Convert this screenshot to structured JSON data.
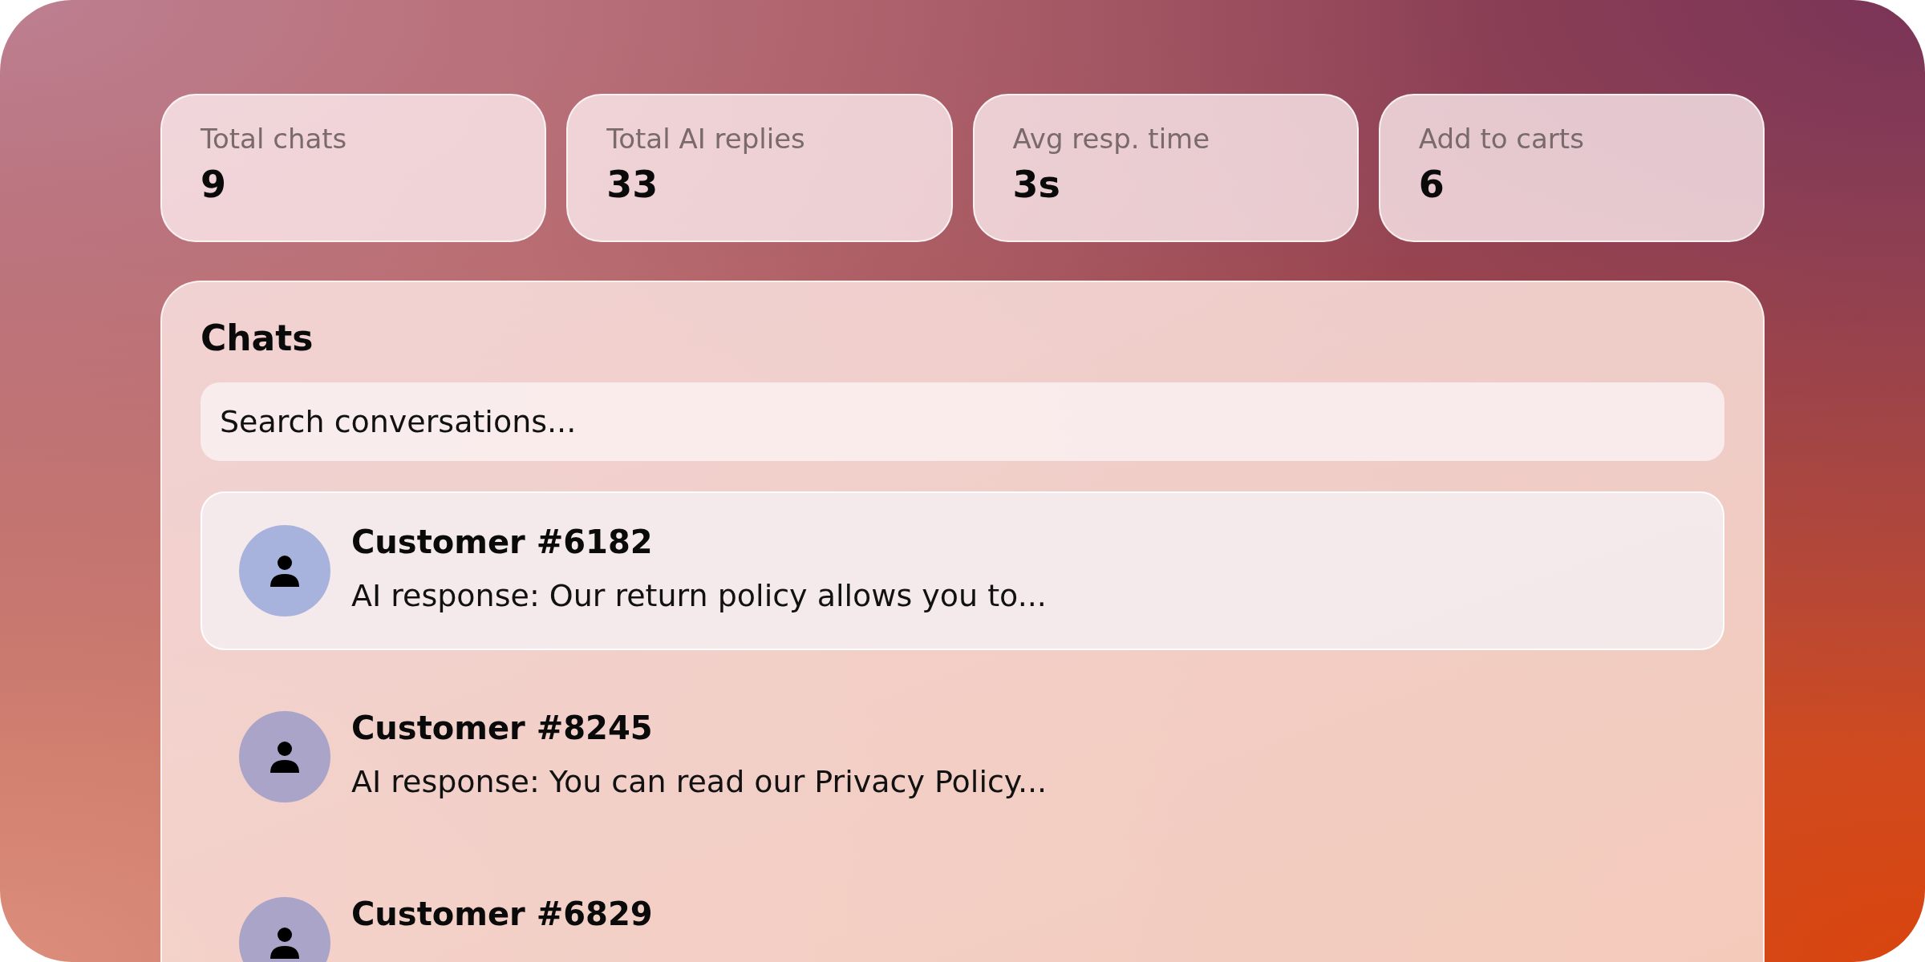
{
  "stats": [
    {
      "label": "Total chats",
      "value": "9"
    },
    {
      "label": "Total AI replies",
      "value": "33"
    },
    {
      "label": "Avg resp. time",
      "value": "3s"
    },
    {
      "label": "Add to carts",
      "value": "6"
    }
  ],
  "chats": {
    "title": "Chats",
    "search": {
      "placeholder": "Search conversations..."
    },
    "items": [
      {
        "name": "Customer #6182",
        "preview": "AI response: Our return policy allows you to...",
        "selected": true
      },
      {
        "name": "Customer #8245",
        "preview": "AI response: You can read our Privacy Policy...",
        "selected": false
      },
      {
        "name": "Customer #6829",
        "selected": false
      }
    ]
  }
}
